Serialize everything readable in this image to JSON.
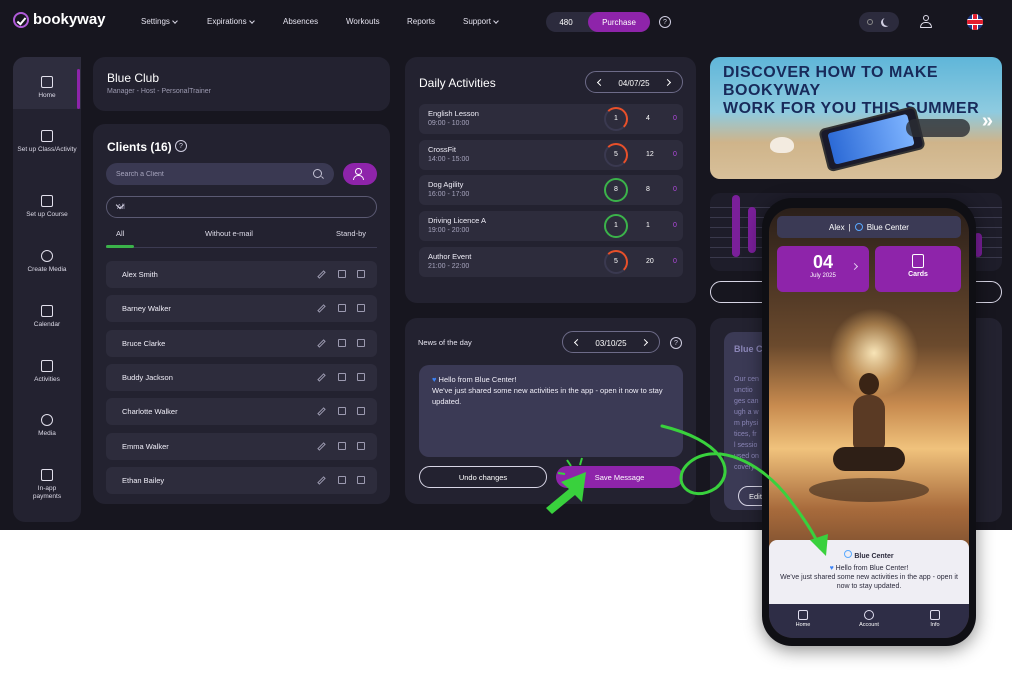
{
  "brand": {
    "name": "bookyway"
  },
  "nav": {
    "items": [
      {
        "label": "Settings",
        "dropdown": true
      },
      {
        "label": "Expirations",
        "dropdown": true
      },
      {
        "label": "Absences",
        "dropdown": false
      },
      {
        "label": "Workouts",
        "dropdown": false
      },
      {
        "label": "Reports",
        "dropdown": false
      },
      {
        "label": "Support",
        "dropdown": true
      }
    ],
    "credits": "480",
    "purchase_label": "Purchase",
    "help": "?",
    "language": "English (UK)"
  },
  "sidebar": {
    "items": [
      {
        "label": "Home",
        "icon": "grid-icon",
        "active": true
      },
      {
        "label": "Set up Class/Activity",
        "icon": "edit-icon",
        "active": false
      },
      {
        "label": "Set up Course",
        "icon": "card-icon",
        "active": false
      },
      {
        "label": "Create Media",
        "icon": "plus-circle-icon",
        "active": false
      },
      {
        "label": "Calendar",
        "icon": "calendar-icon",
        "active": false
      },
      {
        "label": "Activities",
        "icon": "list-icon",
        "active": false
      },
      {
        "label": "Media",
        "icon": "play-icon",
        "active": false
      },
      {
        "label": "In-app payments",
        "icon": "credit-card-icon",
        "active": false
      }
    ]
  },
  "club": {
    "name": "Blue Club",
    "roles": "Manager - Host - PersonalTrainer"
  },
  "clients": {
    "title": "Clients (16)",
    "help": "?",
    "search_placeholder": "Search a Client",
    "filter_value": "All",
    "tabs": [
      {
        "label": "All"
      },
      {
        "label": "Without e-mail"
      },
      {
        "label": "Stand-by"
      }
    ],
    "rows": [
      "Alex Smith",
      "Barney Walker",
      "Bruce Clarke",
      "Buddy Jackson",
      "Charlotte Walker",
      "Emma Walker",
      "Ethan Bailey"
    ]
  },
  "daily": {
    "title": "Daily Activities",
    "date": "04/07/25",
    "activities": [
      {
        "name": "English Lesson",
        "time": "09:00 - 10:00",
        "booked": "1",
        "capacity": "4",
        "waiting": "0",
        "ring_color": "#e8502a"
      },
      {
        "name": "CrossFit",
        "time": "14:00 - 15:00",
        "booked": "5",
        "capacity": "12",
        "waiting": "0",
        "ring_color": "#e8502a"
      },
      {
        "name": "Dog Agility",
        "time": "16:00 - 17:00",
        "booked": "8",
        "capacity": "8",
        "waiting": "0",
        "ring_color": "#3bb34a"
      },
      {
        "name": "Driving Licence A",
        "time": "19:00 - 20:00",
        "booked": "1",
        "capacity": "1",
        "waiting": "0",
        "ring_color": "#3bb34a"
      },
      {
        "name": "Author Event",
        "time": "21:00 - 22:00",
        "booked": "5",
        "capacity": "20",
        "waiting": "0",
        "ring_color": "#e8502a"
      }
    ]
  },
  "news": {
    "label": "News of the day",
    "date": "03/10/25",
    "help": "?",
    "message_heading": "Hello from Blue Center!",
    "message_body": "We've just shared some new activities in the app - open it now to stay updated.",
    "undo_label": "Undo changes",
    "save_label": "Save Message"
  },
  "banner": {
    "line1": "Discover how to make Bookyway",
    "line2": "work for you this summer"
  },
  "info": {
    "title": "Blue C",
    "lines": [
      "Our cen",
      "unctio",
      "ges can",
      "ugh a w",
      "m physi",
      "tices, fr",
      "l sessio",
      "used on",
      "covery."
    ],
    "edit_label": "Edit Inform"
  },
  "phone": {
    "user": "Alex",
    "center": "Blue Center",
    "day": "04",
    "month": "July",
    "year": "2025",
    "cards_label": "Cards",
    "notification_title": "Blue Center",
    "notification_heading": "Hello from Blue Center!",
    "notification_body": "We've just shared some new activities in the app - open it now to stay updated.",
    "tabs": [
      "Home",
      "Account",
      "Info"
    ]
  },
  "colors": {
    "accent": "#8e24aa",
    "green": "#3bb34a",
    "orange": "#e8502a",
    "background": "#17161f",
    "panel": "#232230"
  }
}
